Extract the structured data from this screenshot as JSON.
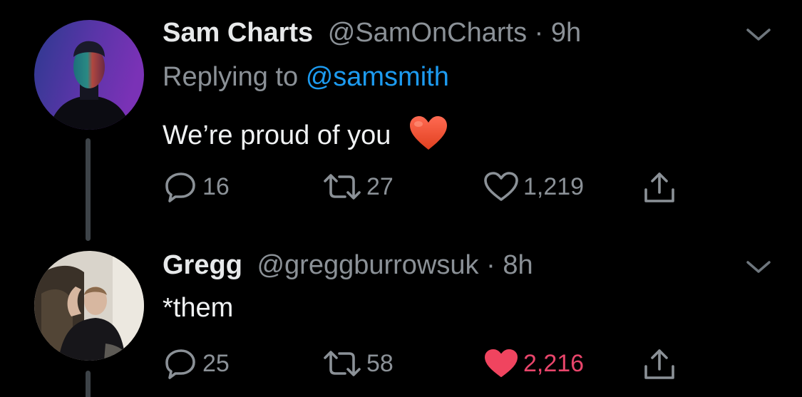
{
  "tweets": [
    {
      "display_name": "Sam Charts",
      "handle": "@SamOnCharts",
      "separator": "·",
      "time": "9h",
      "replying_prefix": "Replying to",
      "replying_handle": "@samsmith",
      "text": "We’re proud of you",
      "emoji": "red-heart",
      "actions": {
        "replies": "16",
        "retweets": "27",
        "likes": "1,219"
      },
      "liked": false
    },
    {
      "display_name": "Gregg",
      "handle": "@greggburrowsuk",
      "separator": "·",
      "time": "8h",
      "text": "*them",
      "actions": {
        "replies": "25",
        "retweets": "58",
        "likes": "2,216"
      },
      "liked": true
    }
  ],
  "colors": {
    "background": "#000000",
    "primary_text": "#e7e9ea",
    "secondary_text": "#8b9197",
    "link": "#1d9bf0",
    "liked": "#f91880"
  },
  "icons": {
    "reply": "reply-icon",
    "retweet": "retweet-icon",
    "like": "heart-icon",
    "share": "share-icon",
    "menu": "chevron-down-icon"
  }
}
